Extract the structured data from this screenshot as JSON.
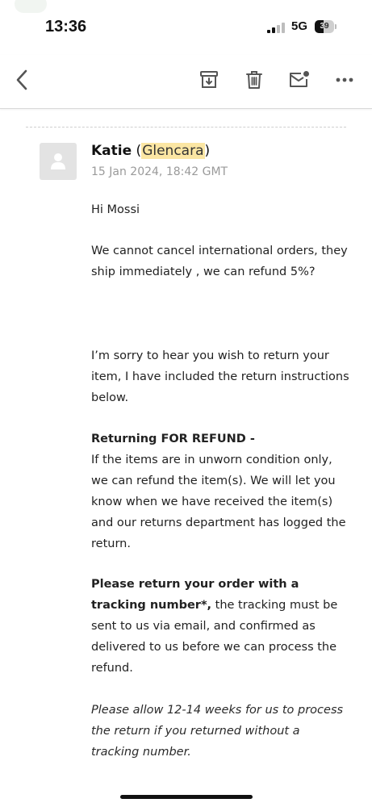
{
  "status_bar": {
    "time": "13:36",
    "network": "5G",
    "battery_level": "39"
  },
  "toolbar": {
    "back_icon": "chevron-left-icon",
    "archive_icon": "archive-icon",
    "trash_icon": "trash-icon",
    "unread_icon": "mark-unread-icon",
    "more_icon": "more-horizontal-icon"
  },
  "email": {
    "sender_name": "Katie",
    "sender_org": "Glencara",
    "date": "15 Jan 2024, 18:42 GMT",
    "greeting": "Hi Mossi",
    "p1": "We cannot cancel international orders, they ship immediately , we can refund 5%?",
    "p2": "I’m sorry to hear you wish to return your item, I have included the return instructions below.",
    "p3_heading": "Returning FOR REFUND -",
    "p3_text": "If the items are in unworn condition only, we can refund the item(s). We will let you know when we have received the item(s) and our returns department has logged the return.",
    "p4_bold": "Please return your order with a tracking number*,",
    "p4_text": " the tracking must be sent to us via email, and confirmed as delivered to us before we can process the refund.",
    "p5_italic": "Please allow 12-14 weeks for us to process the return if you returned without a tracking number."
  },
  "colors": {
    "highlight": "#fbe6a3",
    "date_gray": "#9a9a9a",
    "icon_gray": "#555555"
  }
}
